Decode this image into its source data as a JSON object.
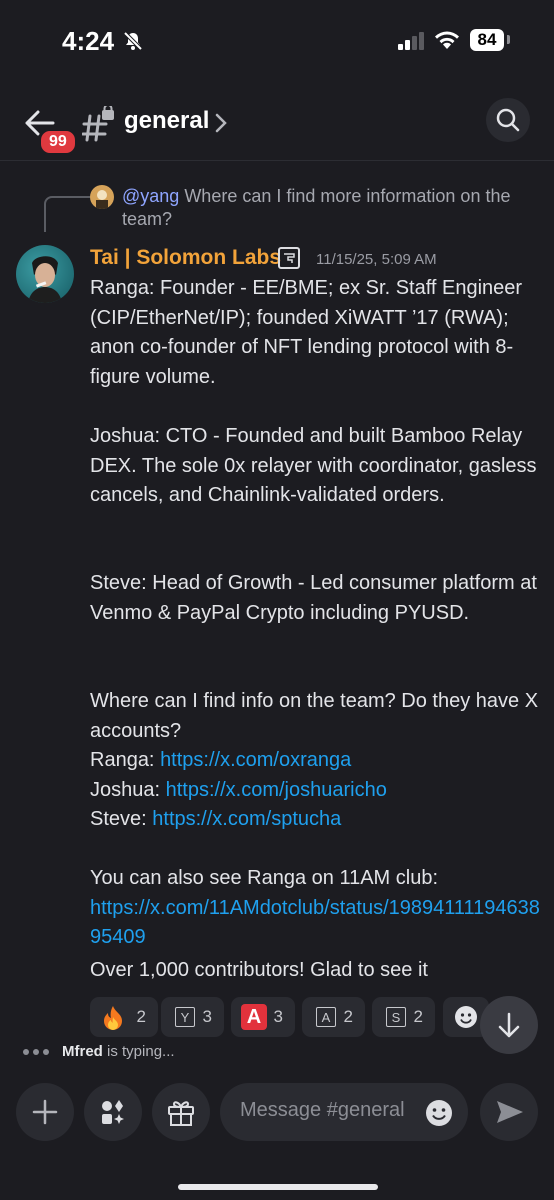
{
  "status": {
    "time": "4:24",
    "battery": "84"
  },
  "header": {
    "back_badge": "99",
    "channel": "general"
  },
  "reply": {
    "mention": "@yang",
    "text": " Where can I find more information on the team?"
  },
  "message": {
    "author": "Tai | Solomon Labs",
    "timestamp": "11/15/25, 5:09 AM",
    "para1": "Ranga: Founder - EE/BME; ex Sr. Staff Engineer (CIP/EtherNet/IP); founded XiWATT ’17 (RWA); anon co-founder of NFT lending protocol with 8-figure volume.",
    "para2": "Joshua: CTO - Founded and built Bamboo Relay DEX. The sole 0x relayer with coordinator, gasless cancels, and Chainlink-validated orders.",
    "para3": "Steve: Head of Growth - Led consumer platform at Venmo & PayPal Crypto including PYUSD.",
    "para4": "Where can I find info on the team? Do they have X accounts?",
    "links": [
      {
        "label": "Ranga: ",
        "url": "https://x.com/oxranga"
      },
      {
        "label": "Joshua: ",
        "url": "https://x.com/joshuaricho"
      },
      {
        "label": "Steve: ",
        "url": "https://x.com/sptucha"
      }
    ],
    "para5_text": "You can also see Ranga on 11AM club: ",
    "para5_url": "https://x.com/11AMdotclub/status/1989411119463895409",
    "followup": "Over 1,000 contributors! Glad to see it"
  },
  "reactions": [
    {
      "icon": "fire-emoji",
      "count": "2"
    },
    {
      "icon": "y-letter-emoji",
      "glyph": "Y",
      "count": "3"
    },
    {
      "icon": "red-a-emoji",
      "glyph": "A",
      "count": "3"
    },
    {
      "icon": "a-letter-emoji",
      "glyph": "A",
      "count": "2"
    },
    {
      "icon": "s-letter-emoji",
      "glyph": "S",
      "count": "2"
    }
  ],
  "typing": {
    "user": "Mfred",
    "text": " is typing..."
  },
  "composer": {
    "placeholder": "Message #general"
  },
  "colors": {
    "accent": "#1fa0ee",
    "author": "#f2a33a",
    "badge": "#e0393f",
    "background": "#1c1c21"
  }
}
